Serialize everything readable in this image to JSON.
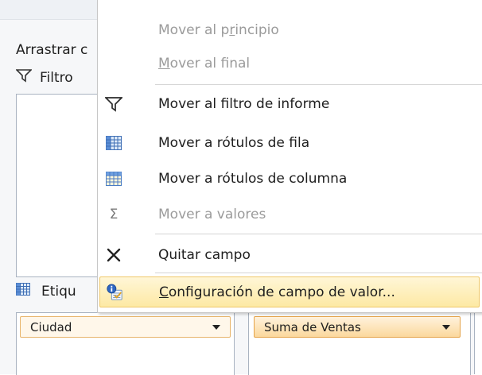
{
  "pane": {
    "drag_label": "Arrastrar c",
    "filter_header": "Filtro",
    "rowlabels_header": "Etiqu",
    "rows_field": "Ciudad",
    "values_field": "Suma de Ventas"
  },
  "menu": {
    "items": [
      {
        "pre": "Mover al p",
        "key": "r",
        "post": "incipio",
        "enabled": false,
        "icon": ""
      },
      {
        "pre": "",
        "key": "M",
        "post": "over al final",
        "enabled": false,
        "icon": ""
      },
      {
        "pre": "Mover al filtro de informe",
        "key": "",
        "post": "",
        "enabled": true,
        "icon": "filter-icon"
      },
      {
        "pre": "Mover a rótulos de fila",
        "key": "",
        "post": "",
        "enabled": true,
        "icon": "row-labels-grid-icon"
      },
      {
        "pre": "Mover a rótulos de columna",
        "key": "",
        "post": "",
        "enabled": true,
        "icon": "column-labels-grid-icon"
      },
      {
        "pre": "Mover a valores",
        "key": "",
        "post": "",
        "enabled": false,
        "icon": "sigma-icon"
      },
      {
        "pre": "Quitar campo",
        "key": "",
        "post": "",
        "enabled": true,
        "icon": "remove-x-icon"
      },
      {
        "pre": "",
        "key": "C",
        "post": "onfiguración de campo de valor...",
        "enabled": true,
        "icon": "field-settings-icon"
      }
    ]
  },
  "colors": {
    "highlight": "#fde9a4",
    "highlight_border": "#efc86a",
    "disabled_text": "#9b9b9b",
    "chip": "#fbd89d"
  }
}
